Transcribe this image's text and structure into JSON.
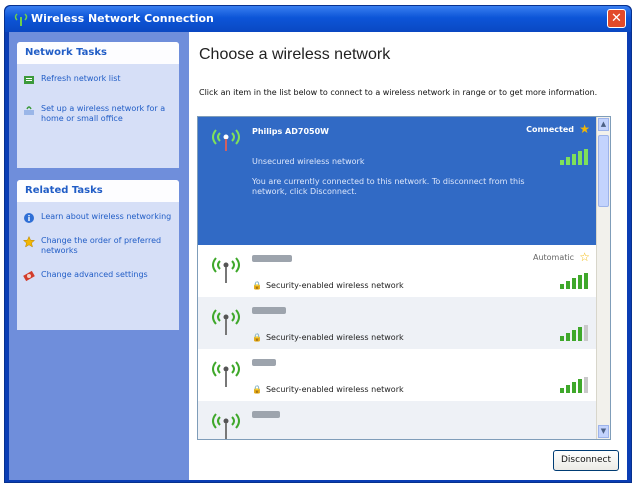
{
  "window": {
    "title": "Wireless Network Connection",
    "close_glyph": "✕"
  },
  "sidebar": {
    "network_tasks": {
      "heading": "Network Tasks",
      "items": [
        {
          "label": "Refresh network list",
          "icon": "refresh-icon"
        },
        {
          "label": "Set up a wireless network for a home or small office",
          "icon": "setup-network-icon"
        }
      ]
    },
    "related_tasks": {
      "heading": "Related Tasks",
      "items": [
        {
          "label": "Learn about wireless networking",
          "icon": "info-icon"
        },
        {
          "label": "Change the order of preferred networks",
          "icon": "star-icon"
        },
        {
          "label": "Change advanced settings",
          "icon": "settings-icon"
        }
      ]
    }
  },
  "main": {
    "title": "Choose a wireless network",
    "instructions": "Click an item in the list below to connect to a wireless network in range or to get more information.",
    "networks": [
      {
        "name": "Philips AD7050W",
        "status": "Connected",
        "type": "Unsecured wireless network",
        "message": "You are currently connected to this network. To disconnect from this network, click Disconnect.",
        "signal": 5
      },
      {
        "name": "",
        "status": "Automatic",
        "security": "Security-enabled wireless network",
        "signal": 5
      },
      {
        "name": "",
        "status": "",
        "security": "Security-enabled wireless network",
        "signal": 4
      },
      {
        "name": "",
        "status": "",
        "security": "Security-enabled wireless network",
        "signal": 4
      },
      {
        "name": "",
        "status": "",
        "security": "",
        "signal": 0
      }
    ],
    "disconnect_label": "Disconnect"
  },
  "colors": {
    "titlebar": "#0c55d8",
    "selection": "#316ac5",
    "sidebar": "#6f8edb",
    "signal": "#3fa82b"
  }
}
